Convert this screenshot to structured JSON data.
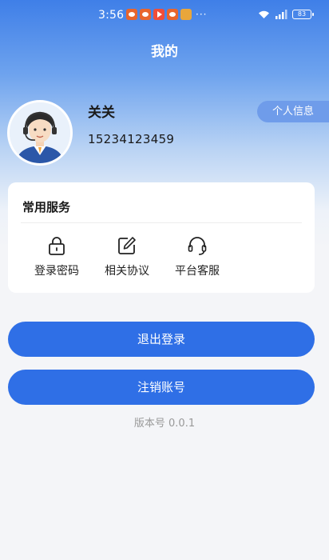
{
  "status_bar": {
    "time": "3:56",
    "more": "···",
    "battery": "83",
    "notification_icons": [
      "weibo-icon",
      "weibo-icon",
      "play-icon",
      "weibo-icon",
      "picture-icon"
    ]
  },
  "header": {
    "title": "我的"
  },
  "user": {
    "name": "关关",
    "phone": "15234123459",
    "profile_button": "个人信息"
  },
  "services": {
    "title": "常用服务",
    "items": [
      {
        "label": "登录密码",
        "icon": "lock-icon"
      },
      {
        "label": "相关协议",
        "icon": "edit-icon"
      },
      {
        "label": "平台客服",
        "icon": "headset-icon"
      }
    ]
  },
  "actions": {
    "logout": "退出登录",
    "cancel_account": "注销账号"
  },
  "footer": {
    "version": "版本号 0.0.1"
  },
  "colors": {
    "primary": "#2f6fe6",
    "header_gradient_top": "#3f7fe8",
    "profile_tag": "#6f9cea",
    "background": "#f4f5f8"
  }
}
